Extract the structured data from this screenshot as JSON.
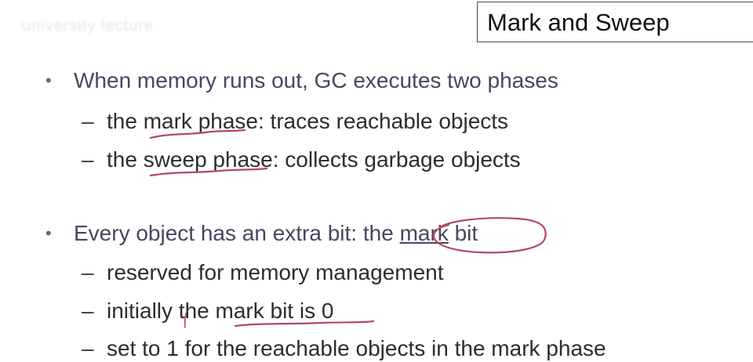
{
  "watermark": "university lecture",
  "title": "Mark and Sweep",
  "bullets": [
    {
      "text": "When memory runs out, GC executes two phases",
      "subs": [
        {
          "pre": "the ",
          "hl": "mark phase",
          "post": ": traces reachable objects"
        },
        {
          "pre": "the ",
          "hl": "sweep phase",
          "post": ": collects garbage objects"
        }
      ]
    },
    {
      "pre": "Every object has an extra bit: the ",
      "hl": "mark",
      "post": " bit",
      "subs": [
        {
          "text": "reserved for memory management"
        },
        {
          "pre": "initially the ",
          "hl": "mark bit is 0",
          "post": ""
        },
        {
          "text": "set to 1 for the reachable objects in the mark phase"
        }
      ]
    }
  ],
  "colors": {
    "annotation": "#b5485e",
    "bullet_text": "#46475f",
    "sub_text": "#2d2d2d"
  },
  "icons": {
    "bullet": "bullet-dot",
    "dash": "en-dash"
  }
}
